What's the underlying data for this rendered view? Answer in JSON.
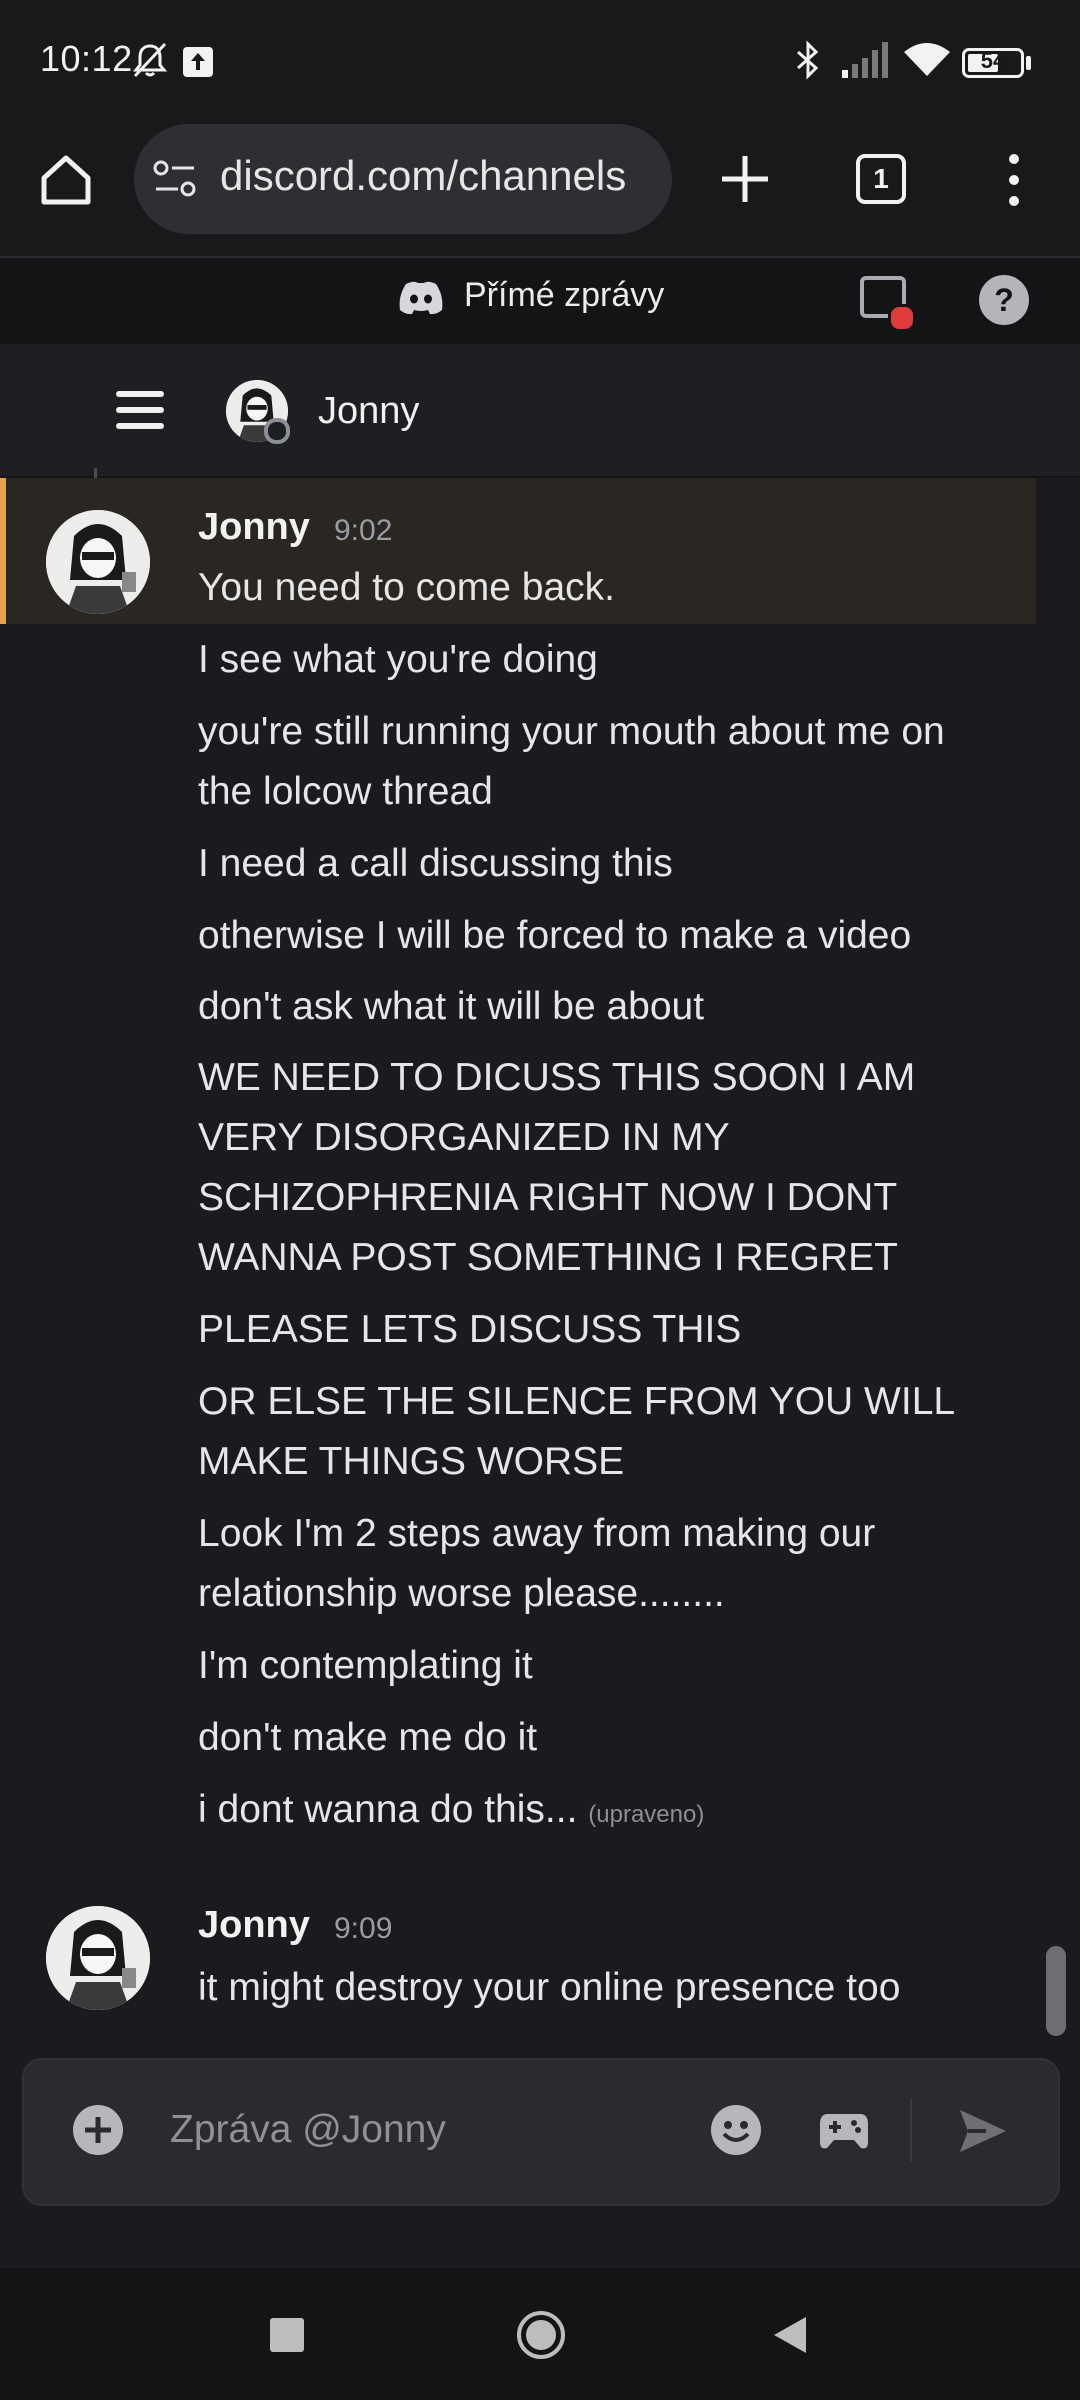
{
  "status_bar": {
    "time": "10:12",
    "battery": "54",
    "icons": [
      "silent-bell-icon",
      "upload-icon",
      "bluetooth-icon",
      "signal-icon",
      "wifi-icon",
      "battery-icon"
    ]
  },
  "browser": {
    "url": "discord.com/channels",
    "tab_count": "1",
    "icons": [
      "home-icon",
      "site-settings-icon",
      "new-tab-plus-icon",
      "tabs-icon",
      "overflow-menu-icon"
    ]
  },
  "discord_header": {
    "title": "Přímé zprávy",
    "icons": [
      "discord-logo-icon",
      "inbox-icon",
      "help-icon"
    ],
    "inbox_badge_color": "#e03a3a"
  },
  "channel": {
    "name": "Jonny",
    "icons": [
      "hamburger-menu-icon",
      "avatar"
    ]
  },
  "messages": [
    {
      "author": "Jonny",
      "time": "9:02",
      "highlighted": true,
      "highlight_color": "#e7a34a",
      "lines": [
        "You need to come back.",
        "I see what you're doing",
        "you're still running your mouth about me on the lolcow thread",
        "I need a call discussing this",
        "otherwise I will be forced to make a video",
        "don't ask what it will be about",
        "WE NEED TO DICUSS THIS SOON I AM VERY DISORGANIZED IN MY SCHIZOPHRENIA RIGHT NOW I DONT WANNA POST SOMETHING I REGRET",
        "PLEASE LETS DISCUSS THIS",
        "OR ELSE THE SILENCE FROM YOU WILL MAKE THINGS WORSE",
        "Look I'm 2 steps away from making our relationship worse please........",
        "I'm contemplating it",
        "don't make me do it",
        "i dont wanna do this..."
      ],
      "edited_label": "(upraveno)"
    },
    {
      "author": "Jonny",
      "time": "9:09",
      "lines": [
        "it might destroy your online presence too"
      ]
    }
  ],
  "composer": {
    "placeholder": "Zpráva @Jonny",
    "icons": [
      "add-attachment-icon",
      "emoji-icon",
      "gamepad-icon",
      "send-icon"
    ]
  },
  "nav_bar": {
    "icons": [
      "recents-square-icon",
      "home-circle-icon",
      "back-triangle-icon"
    ]
  }
}
